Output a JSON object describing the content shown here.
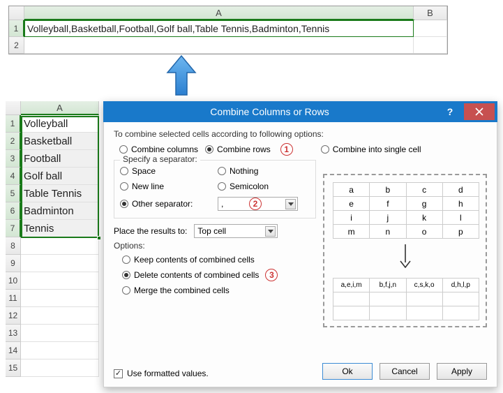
{
  "result_grid": {
    "columns": [
      "A",
      "B"
    ],
    "rows": [
      "1",
      "2"
    ],
    "cell_a1": "Volleyball,Basketball,Football,Golf ball,Table Tennis,Badminton,Tennis"
  },
  "source_grid": {
    "column": "A",
    "rows": [
      "1",
      "2",
      "3",
      "4",
      "5",
      "6",
      "7",
      "8",
      "9",
      "10",
      "11",
      "12",
      "13",
      "14",
      "15"
    ],
    "values": [
      "Volleyball",
      "Basketball",
      "Football",
      "Golf ball",
      "Table Tennis",
      "Badminton",
      "Tennis"
    ]
  },
  "dialog": {
    "title": "Combine Columns or Rows",
    "intro": "To combine selected cells according to following options:",
    "combine": {
      "columns": "Combine columns",
      "rows": "Combine rows",
      "single": "Combine into single cell"
    },
    "callouts": {
      "one": "1",
      "two": "2",
      "three": "3"
    },
    "separator": {
      "label": "Specify a separator:",
      "space": "Space",
      "nothing": "Nothing",
      "newline": "New line",
      "semicolon": "Semicolon",
      "other": "Other separator:",
      "other_value": ","
    },
    "place": {
      "label": "Place the results to:",
      "value": "Top cell"
    },
    "options": {
      "label": "Options:",
      "keep": "Keep contents of combined cells",
      "delete": "Delete contents of combined cells",
      "merge": "Merge the combined cells"
    },
    "formatted": "Use formatted values.",
    "buttons": {
      "ok": "Ok",
      "cancel": "Cancel",
      "apply": "Apply"
    },
    "preview": {
      "before": [
        [
          "a",
          "b",
          "c",
          "d"
        ],
        [
          "e",
          "f",
          "g",
          "h"
        ],
        [
          "i",
          "j",
          "k",
          "l"
        ],
        [
          "m",
          "n",
          "o",
          "p"
        ]
      ],
      "after": [
        "a,e,i,m",
        "b,f,j,n",
        "c,s,k,o",
        "d,h,l,p"
      ]
    }
  }
}
